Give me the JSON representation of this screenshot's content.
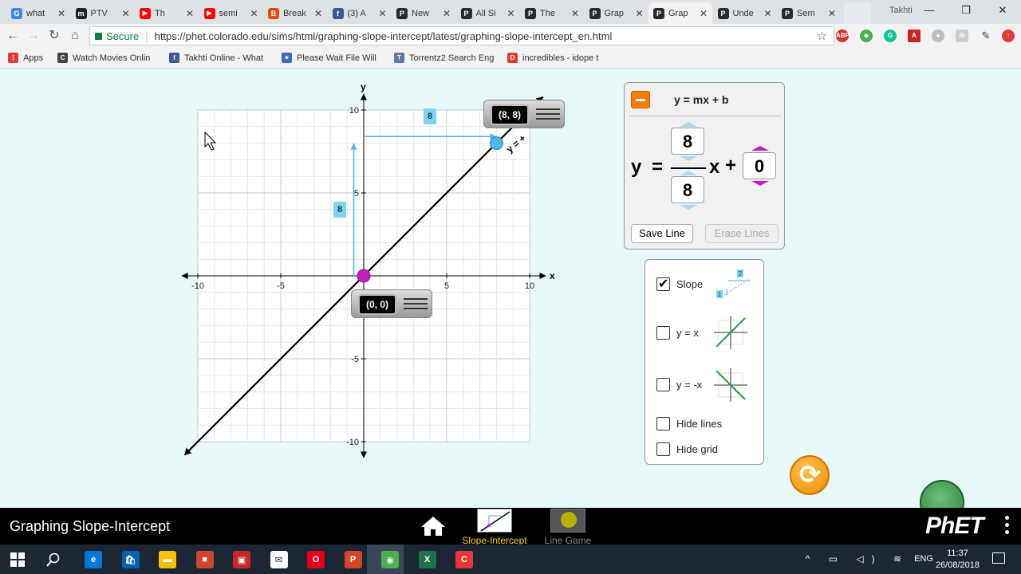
{
  "browser": {
    "tabs": [
      {
        "title": "what",
        "color": "#4285f4",
        "glyph": "G"
      },
      {
        "title": "PTV",
        "color": "#222222",
        "glyph": "m"
      },
      {
        "title": "Th",
        "color": "#ff0000",
        "glyph": "▶"
      },
      {
        "title": "semi",
        "color": "#ff0000",
        "glyph": "▶"
      },
      {
        "title": "Break",
        "color": "#e65100",
        "glyph": "B"
      },
      {
        "title": "(3) A",
        "color": "#3b5998",
        "glyph": "f"
      },
      {
        "title": "New",
        "color": "#2b2b2b",
        "glyph": "P"
      },
      {
        "title": "All Si",
        "color": "#2b2b2b",
        "glyph": "P"
      },
      {
        "title": "The",
        "color": "#2b2b2b",
        "glyph": "P"
      },
      {
        "title": "Grap",
        "color": "#2b2b2b",
        "glyph": "P"
      },
      {
        "title": "Grap",
        "color": "#2b2b2b",
        "glyph": "P"
      },
      {
        "title": "Unde",
        "color": "#2b2b2b",
        "glyph": "P"
      },
      {
        "title": "Sem",
        "color": "#2b2b2b",
        "glyph": "P"
      }
    ],
    "profile_name": "Takhti",
    "secure_label": "Secure",
    "url": "https://phet.colorado.edu/sims/html/graphing-slope-intercept/latest/graphing-slope-intercept_en.html",
    "bookmarks": [
      {
        "label": "Apps",
        "color": "#e53935",
        "glyph": "⋮"
      },
      {
        "label": "Watch Movies Onlin",
        "color": "#444444",
        "glyph": "C"
      },
      {
        "label": "Takhti Online - What",
        "color": "#3b5998",
        "glyph": "f"
      },
      {
        "label": "Please Wait File Will",
        "color": "#3c6eb4",
        "glyph": "✷"
      },
      {
        "label": "Torrentz2 Search Eng",
        "color": "#5a7aa0",
        "glyph": "T"
      },
      {
        "label": "incredibles - idope t",
        "color": "#e53935",
        "glyph": "D"
      }
    ]
  },
  "graph": {
    "x_axis_label": "x",
    "y_axis_label": "y",
    "x_ticks": [
      "-10",
      "-5",
      "5",
      "10"
    ],
    "y_ticks": [
      "10",
      "5",
      "-5",
      "-10"
    ],
    "line_label": "y = +",
    "point1_label": "(8, 8)",
    "point2_label": "(0, 0)",
    "rise_label": "8",
    "run_label": "8",
    "line_color": "#000000",
    "slope_color": "#4fb6e6",
    "point_intercept_color": "#c71bc7",
    "point_slope_color": "#4fb6e6"
  },
  "equation_panel": {
    "title": "y = mx + b",
    "y_label": "y",
    "equals": "=",
    "x_label": "x",
    "plus": "+",
    "rise": "8",
    "run": "8",
    "intercept": "0",
    "save_line": "Save Line",
    "erase_lines": "Erase Lines"
  },
  "options_panel": {
    "slope": {
      "label": "Slope",
      "checked": true,
      "icon_rise": "2",
      "icon_run": "1"
    },
    "y_eq_x": {
      "label": "y = x",
      "checked": false
    },
    "y_eq_neg_x": {
      "label": "y = -x",
      "checked": false
    },
    "hide_lines": {
      "label": "Hide lines",
      "checked": false
    },
    "hide_grid": {
      "label": "Hide grid",
      "checked": false
    }
  },
  "navbar": {
    "sim_title": "Graphing Slope-Intercept",
    "screens": [
      {
        "label": "Slope-Intercept",
        "selected": true,
        "color": "#ffd000"
      },
      {
        "label": "Line Game",
        "selected": false,
        "color": "#8a8a8a"
      }
    ],
    "phet_logo": "PhET"
  },
  "taskbar": {
    "lang": "ENG",
    "time": "11:37",
    "date": "26/08/2018",
    "apps": [
      {
        "name": "edge",
        "color": "#0078d7",
        "glyph": "e"
      },
      {
        "name": "store",
        "color": "#0063b1",
        "glyph": "🛍"
      },
      {
        "name": "explorer",
        "color": "#f4c20d",
        "glyph": "▬"
      },
      {
        "name": "app4",
        "color": "#d0452e",
        "glyph": "■"
      },
      {
        "name": "app5",
        "color": "#c62828",
        "glyph": "▣"
      },
      {
        "name": "mail",
        "color": "#ffffff",
        "glyph": "✉"
      },
      {
        "name": "opera",
        "color": "#e2001a",
        "glyph": "O"
      },
      {
        "name": "powerpoint",
        "color": "#d24726",
        "glyph": "P"
      },
      {
        "name": "chrome",
        "color": "#4caf50",
        "glyph": "◉"
      },
      {
        "name": "excel",
        "color": "#217346",
        "glyph": "X"
      },
      {
        "name": "camtasia",
        "color": "#e53935",
        "glyph": "C"
      }
    ]
  }
}
